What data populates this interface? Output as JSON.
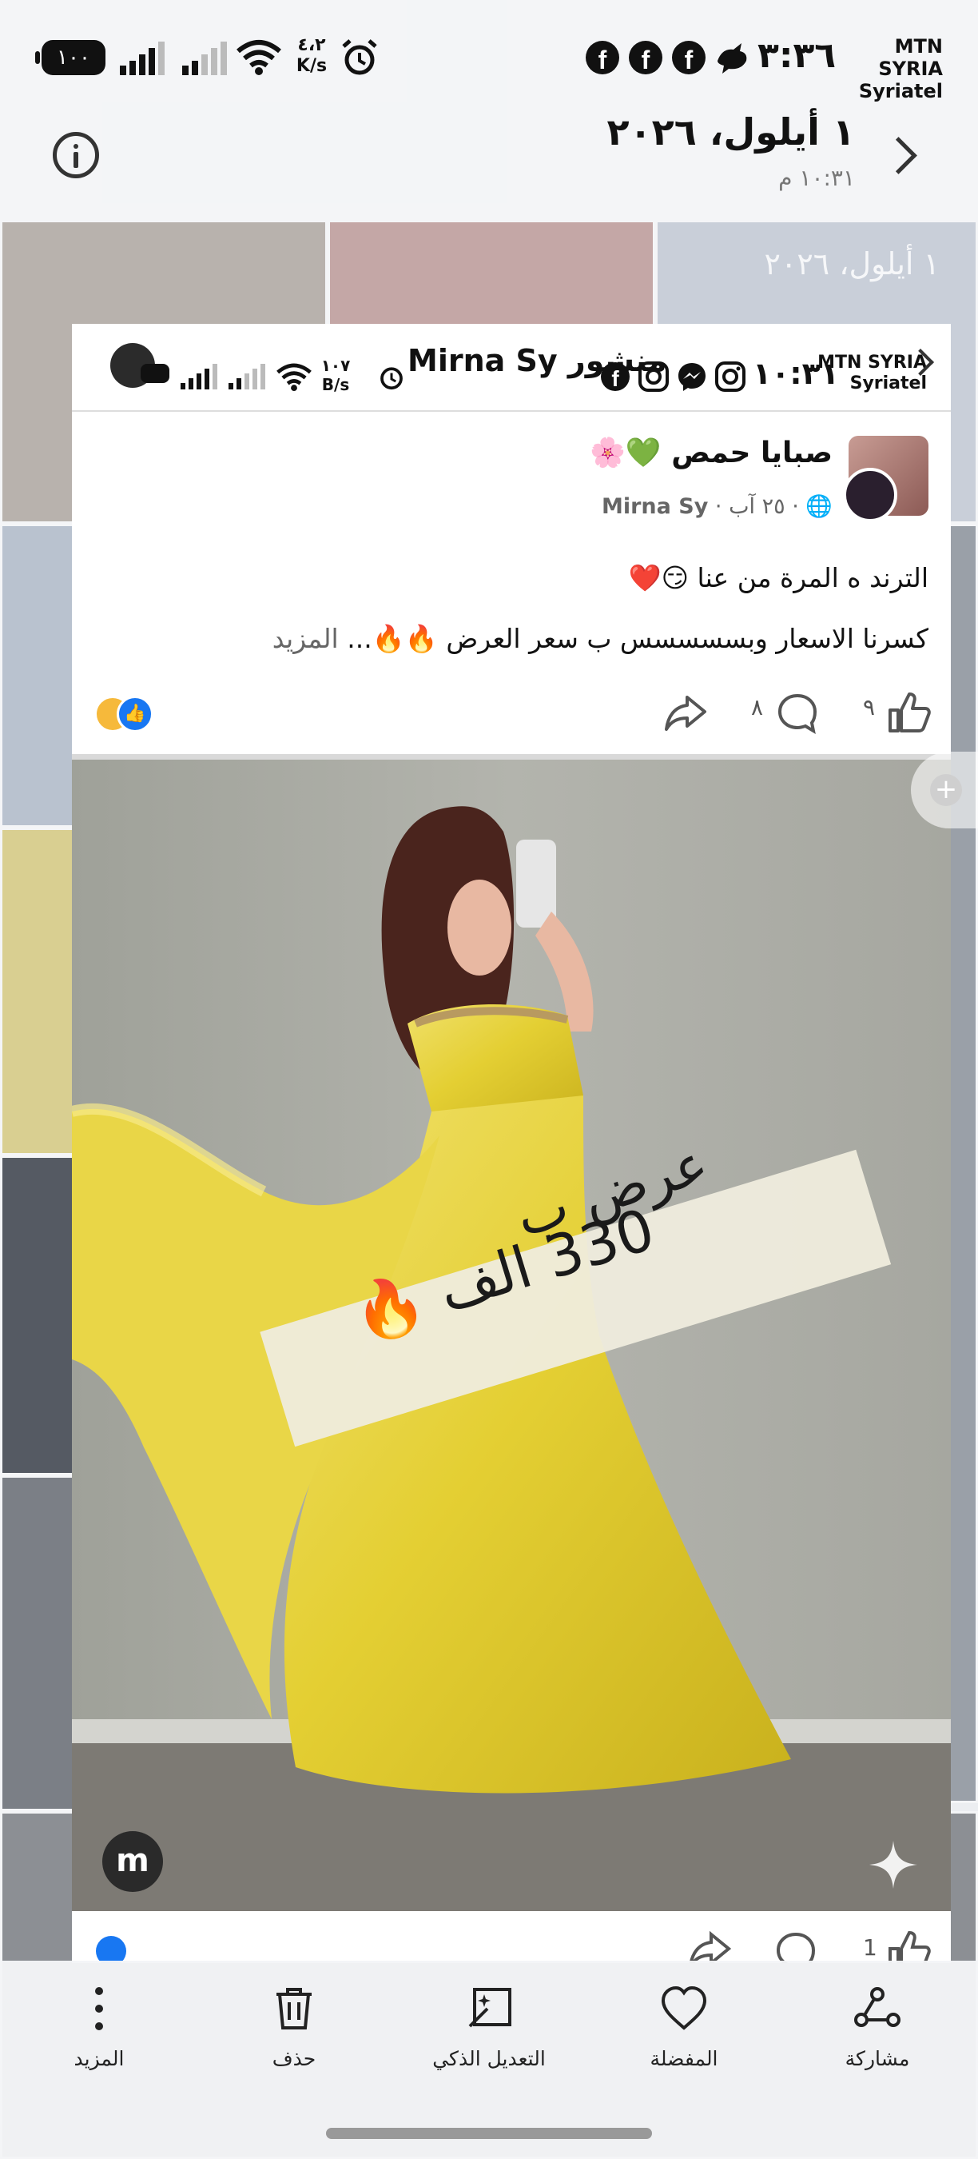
{
  "status_bar": {
    "battery": "١٠٠",
    "net_speed_value": "٤،٢",
    "net_speed_unit": "K/s",
    "time": "٣:٣٦",
    "carrier_1": "MTN SYRIA",
    "carrier_2": "Syriatel",
    "icons": [
      "alarm-icon",
      "wifi-icon",
      "signal-icon",
      "signal-icon",
      "facebook-icon",
      "facebook-icon",
      "facebook-icon",
      "bird-icon"
    ]
  },
  "header": {
    "date": "١ أيلول، ٢٠٢٦",
    "time": "١٠:٣١ م"
  },
  "background": {
    "date_label": "١ أيلول، ٢٠٢٦"
  },
  "screenshot_status": {
    "net_speed_value": "١٠٧",
    "net_speed_unit": "B/s",
    "title": "منشور Mirna Sy",
    "time": "١٠:٣١",
    "carrier_1": "MTN SYRIA",
    "carrier_2": "Syriatel"
  },
  "post": {
    "page_name": "صبايا حمص 💚🌸",
    "meta_date": "٢٥ آب",
    "meta_author": "Mirna Sy",
    "line1": "الترند ه المرة من عنا 😏❤️",
    "line2": "كسرنا الاسعار وبسسسسس ب سعر العرض 🔥🔥...",
    "more": "المزيد",
    "likes": "٩",
    "comments": "٨",
    "image_watermark": "m",
    "image_overlay_line1": "عرض ب",
    "image_overlay_line2": "330 الف",
    "next_likes": "1"
  },
  "bottom_bar": {
    "share": "مشاركة",
    "favorite": "المفضلة",
    "smart_edit": "التعديل الذكي",
    "delete": "حذف",
    "more": "المزيد"
  },
  "colors": {
    "facebook_blue": "#1877f2",
    "dress_yellow": "#e7d33b",
    "wall_gray": "#a7a9a2"
  }
}
